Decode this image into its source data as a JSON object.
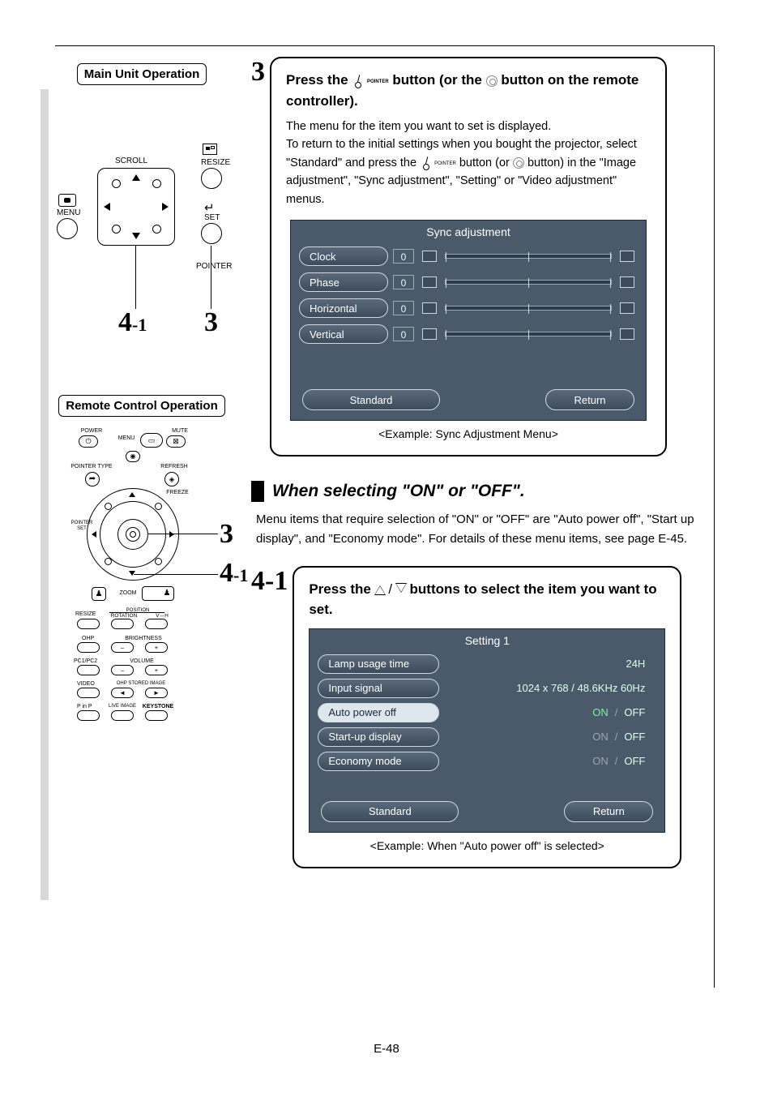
{
  "page_number": "E-48",
  "left": {
    "main_unit_label": "Main Unit Operation",
    "scroll": "SCROLL",
    "resize": "RESIZE",
    "menu": "MENU",
    "set": "SET",
    "pointer": "POINTER",
    "callout_left": "4",
    "callout_left_sub": "-1",
    "callout_right": "3",
    "remote_label": "Remote Control Operation",
    "remote": {
      "power": "POWER",
      "mute": "MUTE",
      "menu": "MENU",
      "pointer_type": "POINTER TYPE",
      "refresh": "REFRESH",
      "freeze": "FREEZE",
      "pointer_set": "POINTER\nSET",
      "zoom": "ZOOM",
      "resize": "RESIZE",
      "position": "POSITION",
      "rotation": "ROTATION",
      "vh": "V↔H",
      "ohp": "OHP",
      "brightness": "BRIGHTNESS",
      "pc": "PC1/PC2",
      "volume": "VOLUME",
      "video": "VIDEO",
      "ohp_stored": "OHP STORED IMAGE",
      "pinp": "P in P",
      "live": "LIVE IMAGE",
      "keystone": "KEYSTONE"
    },
    "remote_callout_3": "3",
    "remote_callout_41": "4",
    "remote_callout_41_sub": "-1"
  },
  "step3": {
    "num": "3",
    "title_a": "Press the ",
    "title_b": " button (or the ",
    "title_c": " button on the remote controller).",
    "body_a": "The menu for the item you want to set is displayed.",
    "body_b": "To return to the initial settings when you bought the projector, select \"Standard\" and press the ",
    "body_c": " button (or ",
    "body_d": " button) in the \"Image adjustment\", \"Sync adjustment\", \"Setting\" or \"Video adjustment\" menus.",
    "pointer_caption": "POINTER",
    "osd": {
      "title": "Sync adjustment",
      "rows": [
        {
          "label": "Clock",
          "value": "0"
        },
        {
          "label": "Phase",
          "value": "0"
        },
        {
          "label": "Horizontal",
          "value": "0"
        },
        {
          "label": "Vertical",
          "value": "0"
        }
      ],
      "standard": "Standard",
      "return": "Return"
    },
    "example": "<Example: Sync Adjustment Menu>"
  },
  "section_on_off": {
    "title": "When selecting \"ON\" or \"OFF\".",
    "body": "Menu items that require selection of \"ON\" or \"OFF\" are \"Auto power off\", \"Start up display\", and \"Economy mode\". For details of these menu items, see page E-45."
  },
  "step41": {
    "num": "4",
    "num_sub": "-1",
    "title_a": "Press the ",
    "title_b": " buttons to select the item you want to set.",
    "osd": {
      "title": "Setting 1",
      "rows": [
        {
          "label": "Lamp usage time",
          "value": "24H"
        },
        {
          "label": "Input signal",
          "value": "1024 x 768 / 48.6KHz  60Hz"
        },
        {
          "label": "Auto power off",
          "on": "ON",
          "sep": "/",
          "off": "OFF",
          "hl": true,
          "off_active": true
        },
        {
          "label": "Start-up display",
          "on": "ON",
          "sep": "/",
          "off": "OFF"
        },
        {
          "label": "Economy mode",
          "on": "ON",
          "sep": "/",
          "off": "OFF"
        }
      ],
      "standard": "Standard",
      "return": "Return"
    },
    "example": "<Example: When \"Auto power off\" is selected>"
  }
}
